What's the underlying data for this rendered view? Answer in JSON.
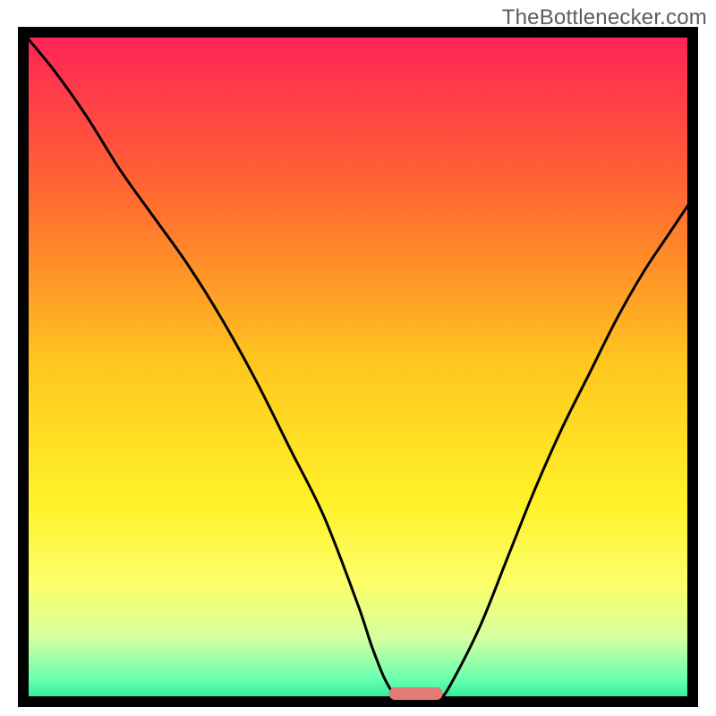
{
  "watermark": "TheBottlenecker.com",
  "chart_data": {
    "type": "line",
    "title": "",
    "xlabel": "",
    "ylabel": "",
    "xlim": [
      0,
      100
    ],
    "ylim": [
      0,
      100
    ],
    "series": [
      {
        "name": "bottleneck-curve",
        "x": [
          0,
          5,
          10,
          15,
          20,
          25,
          30,
          35,
          40,
          45,
          50,
          52,
          54,
          56,
          58,
          60,
          62,
          64,
          68,
          72,
          76,
          80,
          84,
          88,
          92,
          96,
          100
        ],
        "y": [
          100,
          94,
          87,
          79,
          72,
          65,
          57,
          48,
          38,
          28,
          15,
          9,
          4,
          1,
          0,
          0,
          1,
          4,
          12,
          22,
          32,
          41,
          49,
          57,
          64,
          70,
          76
        ]
      }
    ],
    "optimal_marker": {
      "x": 58.5,
      "width": 8
    },
    "background_gradient": {
      "stops": [
        {
          "offset": 0,
          "color": "#ff1f58"
        },
        {
          "offset": 25,
          "color": "#ff6a30"
        },
        {
          "offset": 50,
          "color": "#ffc81e"
        },
        {
          "offset": 70,
          "color": "#fff22a"
        },
        {
          "offset": 82,
          "color": "#fbff6a"
        },
        {
          "offset": 90,
          "color": "#d4ffa0"
        },
        {
          "offset": 96,
          "color": "#66ffb0"
        },
        {
          "offset": 100,
          "color": "#18e08a"
        }
      ]
    },
    "frame_color": "#000000",
    "line_color": "#000000",
    "marker_color": "#e37a74"
  }
}
